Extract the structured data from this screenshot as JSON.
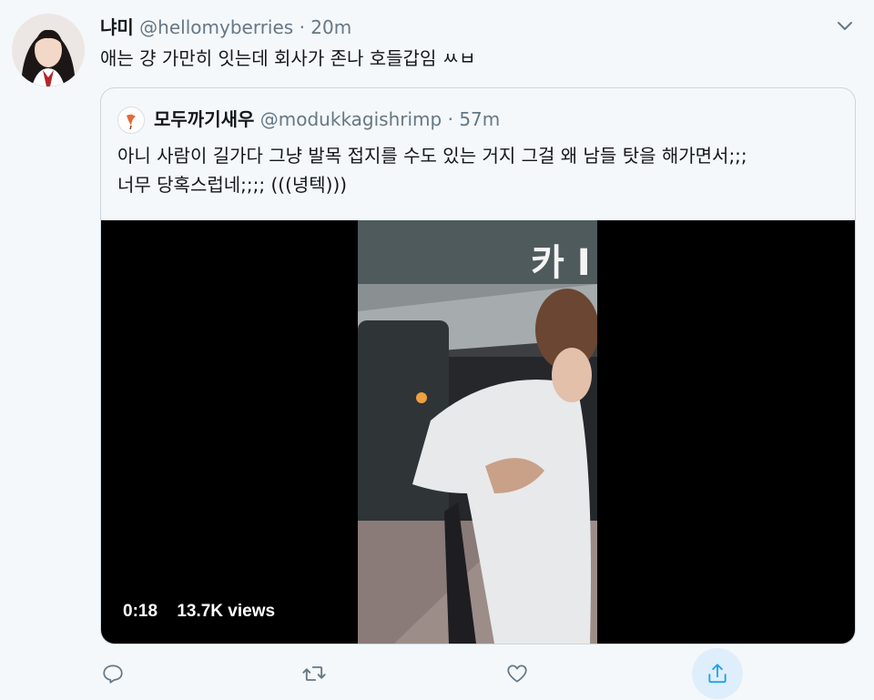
{
  "tweet": {
    "display_name": "냐미",
    "handle": "@hellomyberries",
    "separator": "·",
    "time": "20m",
    "text": "애는 걍 가만히 잇는데 회사가 존나 호들갑임 ㅆㅂ"
  },
  "quoted": {
    "display_name": "모두까기새우",
    "handle": "@modukkagishrimp",
    "separator": "·",
    "time": "57m",
    "text_line1": "아니 사람이 길가다 그냥 발목 접지를 수도 있는 거지 그걸 왜 남들 탓을 해가면서;;;",
    "text_line2": "너무 당혹스럽네;;;; (((녕텍)))",
    "video": {
      "duration": "0:18",
      "views": "13.7K views",
      "sign_text": "카 I"
    }
  },
  "icons": {
    "more": "chevron-down-icon",
    "reply": "reply-icon",
    "retweet": "retweet-icon",
    "like": "heart-icon",
    "share": "share-icon"
  },
  "colors": {
    "background": "#f5f8fa",
    "secondary_text": "#657786",
    "border": "#ccd6dd",
    "share_highlight": "#dfeefb",
    "accent": "#1da1f2"
  }
}
